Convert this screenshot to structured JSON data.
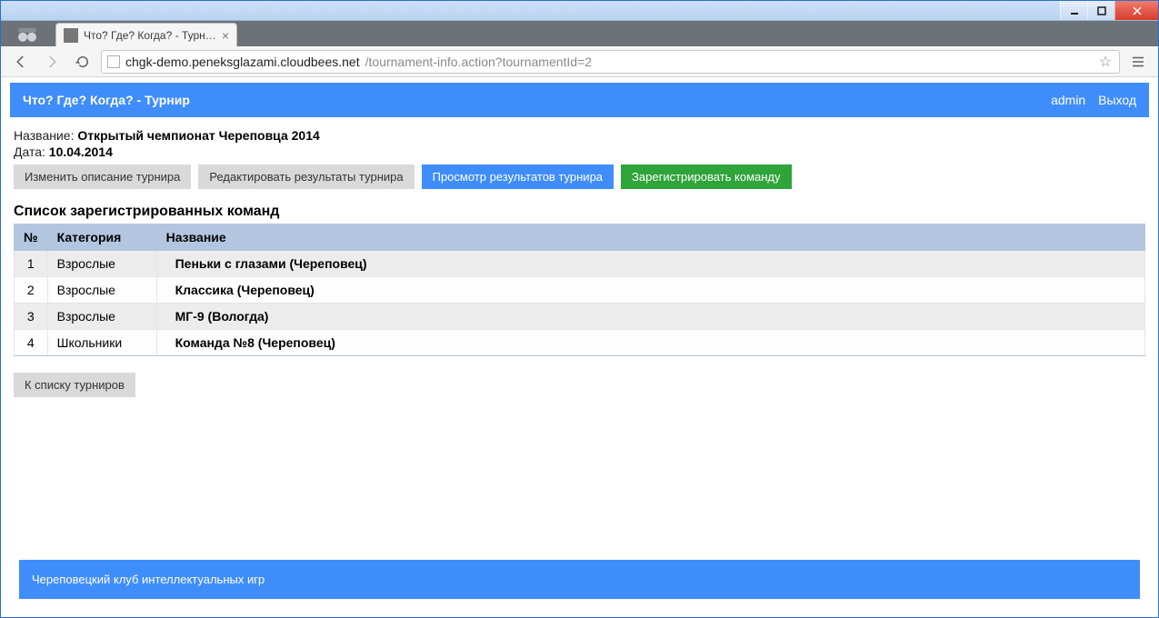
{
  "browser": {
    "tab_title": "Что? Где? Когда? - Турнир",
    "url_host": "chgk-demo.peneksglazami.cloudbees.net",
    "url_path": "/tournament-info.action?tournamentId=2"
  },
  "header": {
    "title": "Что? Где? Когда? - Турнир",
    "user": "admin",
    "logout": "Выход"
  },
  "info": {
    "name_label": "Название:",
    "name_value": "Открытый чемпионат Череповца 2014",
    "date_label": "Дата:",
    "date_value": "10.04.2014"
  },
  "buttons": {
    "edit_desc": "Изменить описание турнира",
    "edit_results": "Редактировать результаты турнира",
    "view_results": "Просмотр результатов турнира",
    "register_team": "Зарегистрировать команду",
    "back": "К списку турниров"
  },
  "table": {
    "title": "Список зарегистрированных команд",
    "headers": {
      "num": "№",
      "category": "Категория",
      "name": "Название"
    },
    "rows": [
      {
        "num": "1",
        "category": "Взрослые",
        "name": "Пеньки с глазами (Череповец)"
      },
      {
        "num": "2",
        "category": "Взрослые",
        "name": "Классика (Череповец)"
      },
      {
        "num": "3",
        "category": "Взрослые",
        "name": "МГ-9 (Вологда)"
      },
      {
        "num": "4",
        "category": "Школьники",
        "name": "Команда №8 (Череповец)"
      }
    ]
  },
  "footer": "Череповецкий клуб интеллектуальных игр"
}
